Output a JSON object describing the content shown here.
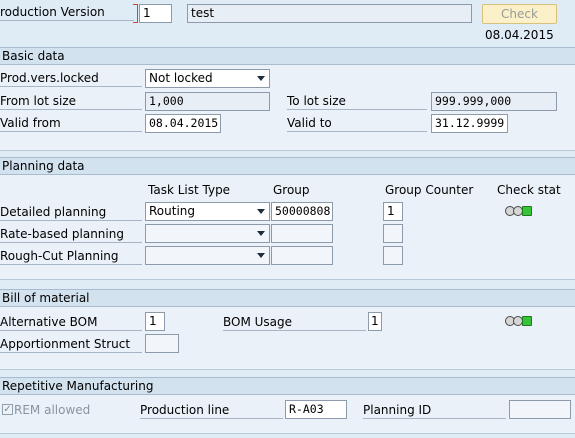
{
  "header": {
    "production_version_label": "roduction Version",
    "production_version_value": "1",
    "description_value": "test",
    "check_button_label": "Check",
    "date": "08.04.2015"
  },
  "basic_data": {
    "section_title": "Basic data",
    "prod_vers_locked_label": "Prod.vers.locked",
    "prod_vers_locked_value": "Not locked",
    "from_lot_size_label": "From lot size",
    "from_lot_size_value": "1,000",
    "to_lot_size_label": "To lot size",
    "to_lot_size_value": "999.999,000",
    "valid_from_label": "Valid from",
    "valid_from_value": "08.04.2015",
    "valid_to_label": "Valid to",
    "valid_to_value": "31.12.9999"
  },
  "planning_data": {
    "section_title": "Planning data",
    "col_task_list_type": "Task List Type",
    "col_group": "Group",
    "col_group_counter": "Group Counter",
    "col_check_stat": "Check stat",
    "rows": [
      {
        "label": "Detailed planning",
        "task_list_type": "Routing",
        "group": "50000808",
        "group_counter": "1",
        "status_colors": [
          "#d6d6d6",
          "#d6d6d6",
          "#39c339"
        ]
      },
      {
        "label": "Rate-based planning",
        "task_list_type": "",
        "group": "",
        "group_counter": ""
      },
      {
        "label": "Rough-Cut Planning",
        "task_list_type": "",
        "group": "",
        "group_counter": ""
      }
    ]
  },
  "bill_of_material": {
    "section_title": "Bill of material",
    "alt_bom_label": "Alternative BOM",
    "alt_bom_value": "1",
    "bom_usage_label": "BOM Usage",
    "bom_usage_value": "1",
    "apportionment_label": "Apportionment Struct",
    "apportionment_value": "",
    "status_colors": [
      "#d6d6d6",
      "#d6d6d6",
      "#39c339"
    ]
  },
  "repetitive_manufacturing": {
    "section_title": "Repetitive Manufacturing",
    "rem_allowed_label": "REM allowed",
    "rem_allowed_checked": true,
    "production_line_label": "Production line",
    "production_line_value": "R-A03",
    "planning_id_label": "Planning ID",
    "planning_id_value": ""
  }
}
